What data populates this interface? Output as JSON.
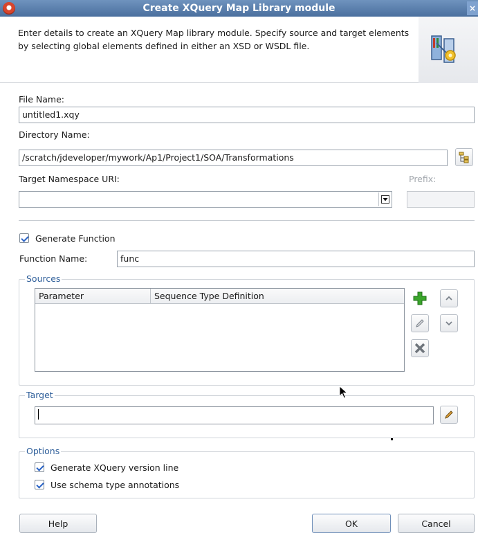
{
  "window": {
    "title": "Create XQuery Map Library module",
    "close_glyph": "×"
  },
  "header": {
    "description": "Enter details to create an XQuery Map library module. Specify source and target elements by selecting global elements defined in either an XSD or WSDL file."
  },
  "form": {
    "file_name_label": "File Name:",
    "file_name_value": "untitled1.xqy",
    "directory_label": "Directory Name:",
    "directory_value": "/scratch/jdeveloper/mywork/Ap1/Project1/SOA/Transformations",
    "namespace_label": "Target Namespace URI:",
    "namespace_value": "",
    "prefix_label": "Prefix:",
    "prefix_value": ""
  },
  "function": {
    "generate_label": "Generate Function",
    "generate_checked": true,
    "name_label": "Function Name:",
    "name_value": "func"
  },
  "sources": {
    "title": "Sources",
    "columns": [
      "Parameter",
      "Sequence Type Definition"
    ]
  },
  "target": {
    "title": "Target",
    "value": ""
  },
  "options": {
    "title": "Options",
    "version_line_label": "Generate XQuery version line",
    "version_line_checked": true,
    "schema_annotations_label": "Use schema type annotations",
    "schema_annotations_checked": true
  },
  "buttons": {
    "help": "Help",
    "ok": "OK",
    "cancel": "Cancel"
  },
  "colors": {
    "title_bar": "#5b7fb0",
    "group_title": "#2f5f9a",
    "check": "#2a63c6",
    "add_green": "#3aa52b",
    "remove_gray": "#6e747b"
  },
  "icons": [
    "app-logo-icon",
    "close-icon",
    "xquery-map-graphic-icon",
    "browse-directory-icon",
    "dropdown-arrow-icon",
    "add-icon",
    "edit-icon",
    "remove-icon",
    "move-up-icon",
    "move-down-icon",
    "edit-target-icon",
    "mouse-cursor-icon"
  ]
}
